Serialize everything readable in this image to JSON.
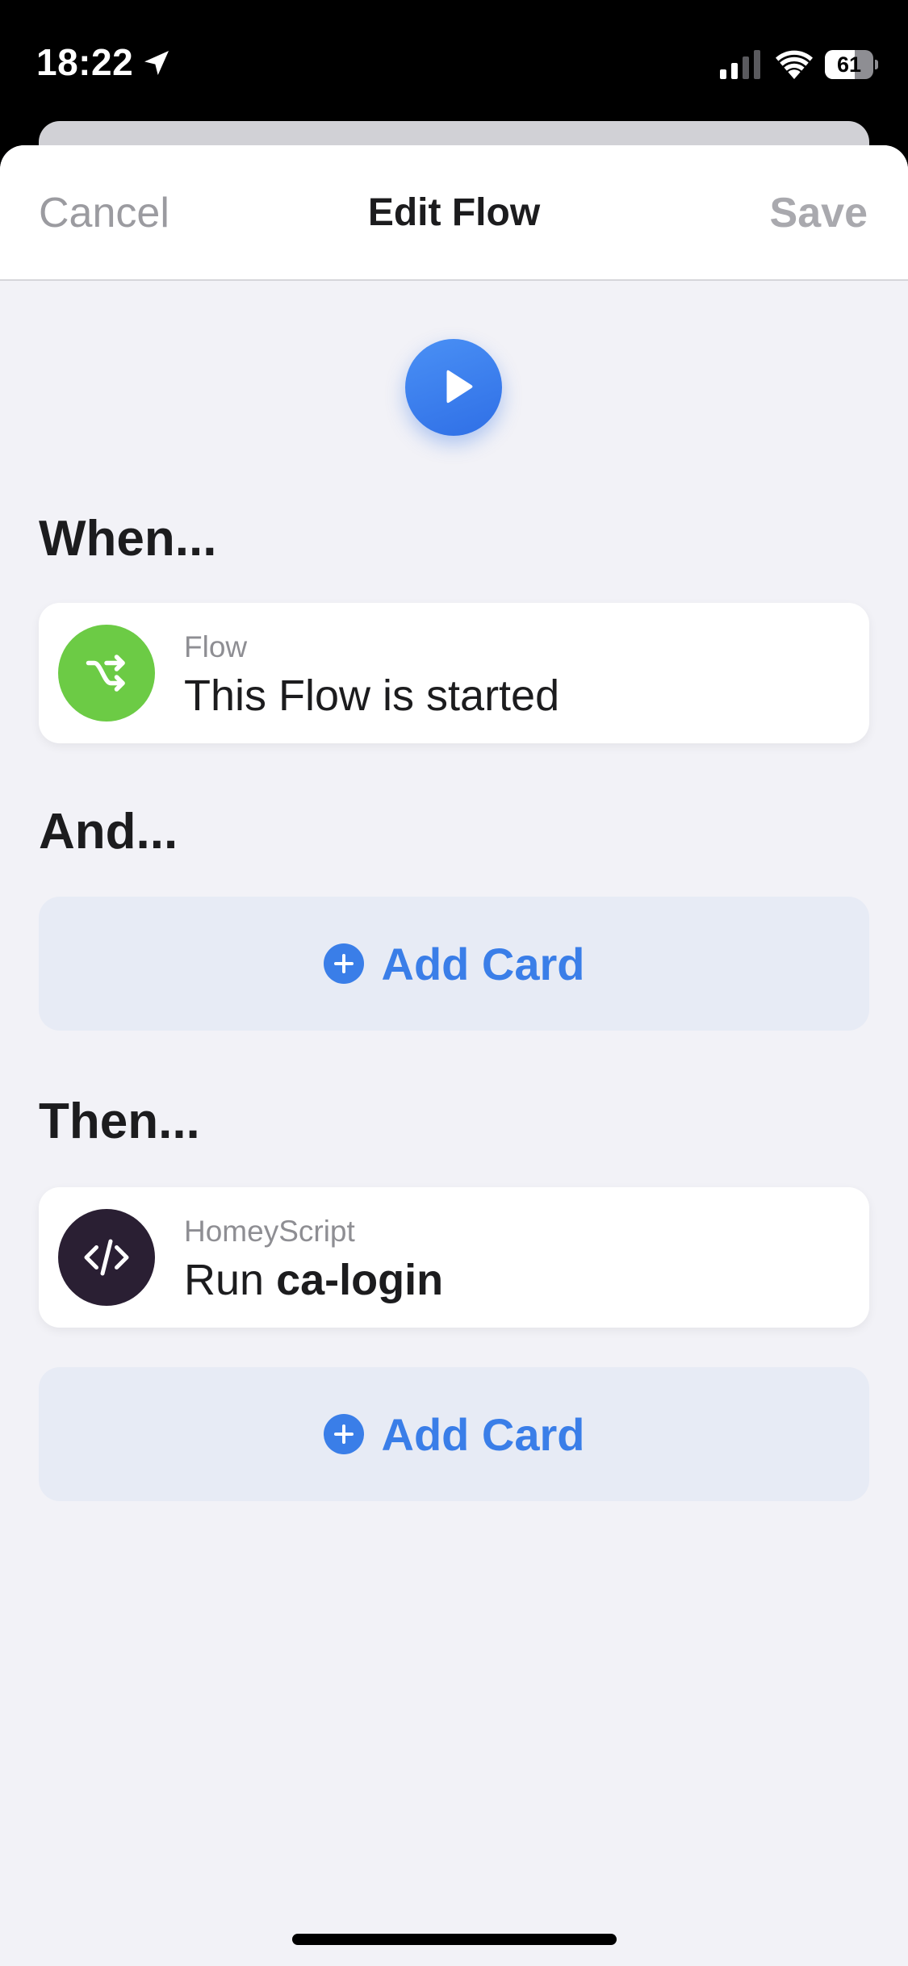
{
  "status_bar": {
    "time": "18:22",
    "battery_percent": "61",
    "battery_level": 0.61,
    "icons": [
      "location-arrow-icon",
      "cellular-signal-icon",
      "wifi-icon",
      "battery-icon"
    ]
  },
  "nav": {
    "cancel_label": "Cancel",
    "title": "Edit Flow",
    "save_label": "Save"
  },
  "play_button": {
    "icon": "play-icon",
    "color": "#3a7ee8"
  },
  "sections": {
    "when": {
      "heading": "When...",
      "card": {
        "category": "Flow",
        "title": "This Flow is started",
        "icon": "flow-shuffle-icon",
        "icon_color": "#6ccb45"
      }
    },
    "and": {
      "heading": "And...",
      "add_card_label": "Add Card"
    },
    "then": {
      "heading": "Then...",
      "card": {
        "category": "HomeyScript",
        "title_prefix": "Run ",
        "title_bold": "ca-login",
        "icon": "code-icon",
        "icon_color": "#2a1f33"
      },
      "add_card_label": "Add Card"
    }
  },
  "colors": {
    "accent": "#3a7ee8",
    "background": "#f2f2f7",
    "add_card_bg": "#e7ebf5"
  }
}
